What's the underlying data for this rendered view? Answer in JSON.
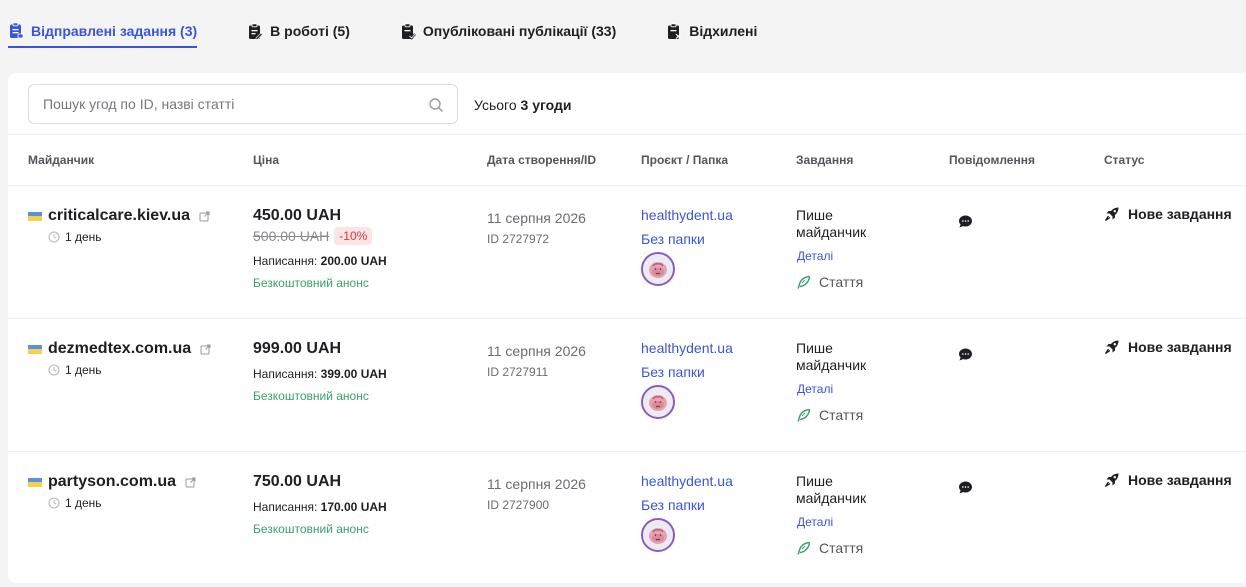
{
  "tabs": [
    {
      "label": "Відправлені задання (3)",
      "icon": "clipboard-list-icon",
      "active": true
    },
    {
      "label": "В роботі (5)",
      "icon": "clipboard-edit-icon",
      "active": false
    },
    {
      "label": "Опубліковані публікації (33)",
      "icon": "clipboard-check-icon",
      "active": false
    },
    {
      "label": "Відхилені",
      "icon": "clipboard-x-icon",
      "active": false
    }
  ],
  "search": {
    "placeholder": "Пошук угод по ID, назві статті"
  },
  "total": {
    "prefix": "Усього",
    "value": "3 угоди"
  },
  "columns": {
    "site": "Майданчик",
    "price": "Ціна",
    "date": "Дата створення/ID",
    "project": "Проєкт / Папка",
    "task": "Завдання",
    "messages": "Повідомлення",
    "status": "Статус"
  },
  "rows": [
    {
      "site": "criticalcare.kiev.ua",
      "duration": "1 день",
      "price": "450.00 UAH",
      "old_price": "500.00 UAH",
      "discount": "-10%",
      "writing_label": "Написання:",
      "writing_value": "200.00 UAH",
      "free": "Безкоштовний анонс",
      "date": "11 серпня 2026",
      "id": "ID 2727972",
      "project": "healthydent.ua",
      "folder": "Без папки",
      "task": "Пише майданчик",
      "details": "Деталі",
      "article": "Стаття",
      "status": "Нове завдання"
    },
    {
      "site": "dezmedtex.com.ua",
      "duration": "1 день",
      "price": "999.00 UAH",
      "old_price": "",
      "discount": "",
      "writing_label": "Написання:",
      "writing_value": "399.00 UAH",
      "free": "Безкоштовний анонс",
      "date": "11 серпня 2026",
      "id": "ID 2727911",
      "project": "healthydent.ua",
      "folder": "Без папки",
      "task": "Пише майданчик",
      "details": "Деталі",
      "article": "Стаття",
      "status": "Нове завдання"
    },
    {
      "site": "partyson.com.ua",
      "duration": "1 день",
      "price": "750.00 UAH",
      "old_price": "",
      "discount": "",
      "writing_label": "Написання:",
      "writing_value": "170.00 UAH",
      "free": "Безкоштовний анонс",
      "date": "11 серпня 2026",
      "id": "ID 2727900",
      "project": "healthydent.ua",
      "folder": "Без папки",
      "task": "Пише майданчик",
      "details": "Деталі",
      "article": "Стаття",
      "status": "Нове завдання"
    }
  ],
  "colors": {
    "accent": "#3b55d9",
    "success": "#38a169",
    "danger": "#d8343b",
    "avatar_ring": "#8a5cc2"
  }
}
